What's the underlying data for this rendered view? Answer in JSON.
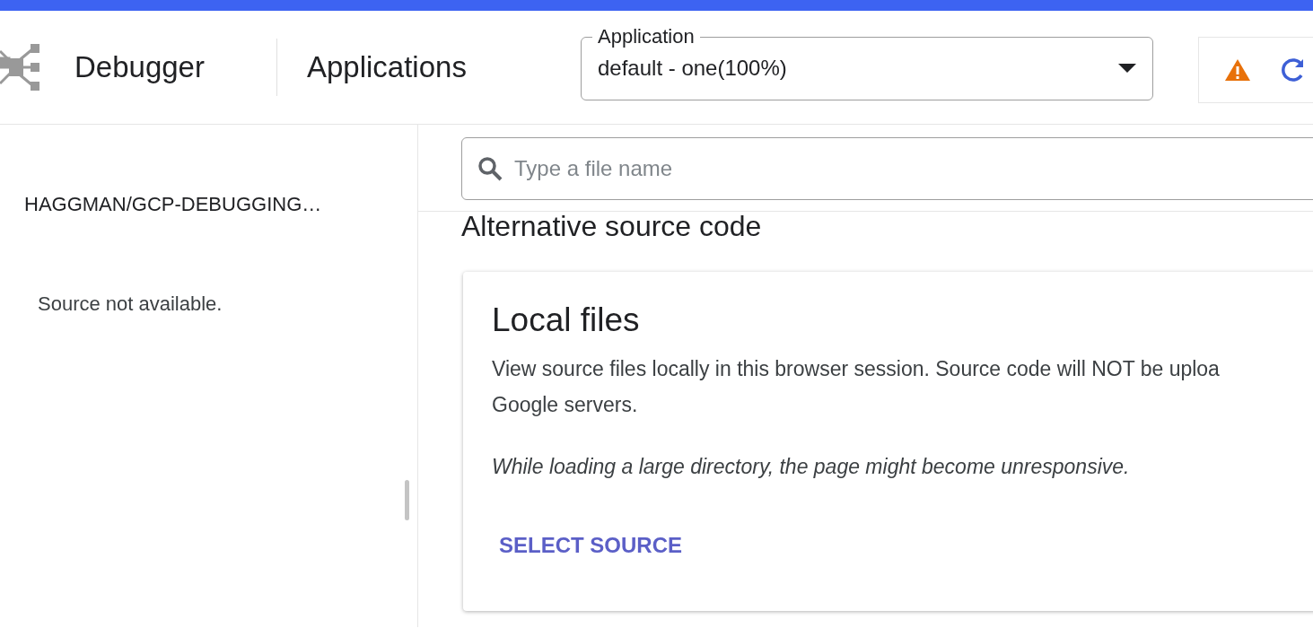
{
  "header": {
    "product": "Debugger",
    "page_title": "Applications",
    "application_select": {
      "label": "Application",
      "value": "default - one(100%)"
    }
  },
  "sidebar": {
    "repository": "HAGGMAN/GCP-DEBUGGING…",
    "message": "Source not available."
  },
  "search": {
    "placeholder": "Type a file name"
  },
  "section_title": "Alternative source code",
  "card": {
    "title": "Local files",
    "description_lines": [
      "View source files locally in this browser session. Source code will NOT be uploa",
      "Google servers."
    ],
    "note": "While loading a large directory, the page might become unresponsive.",
    "action": "SELECT SOURCE"
  }
}
